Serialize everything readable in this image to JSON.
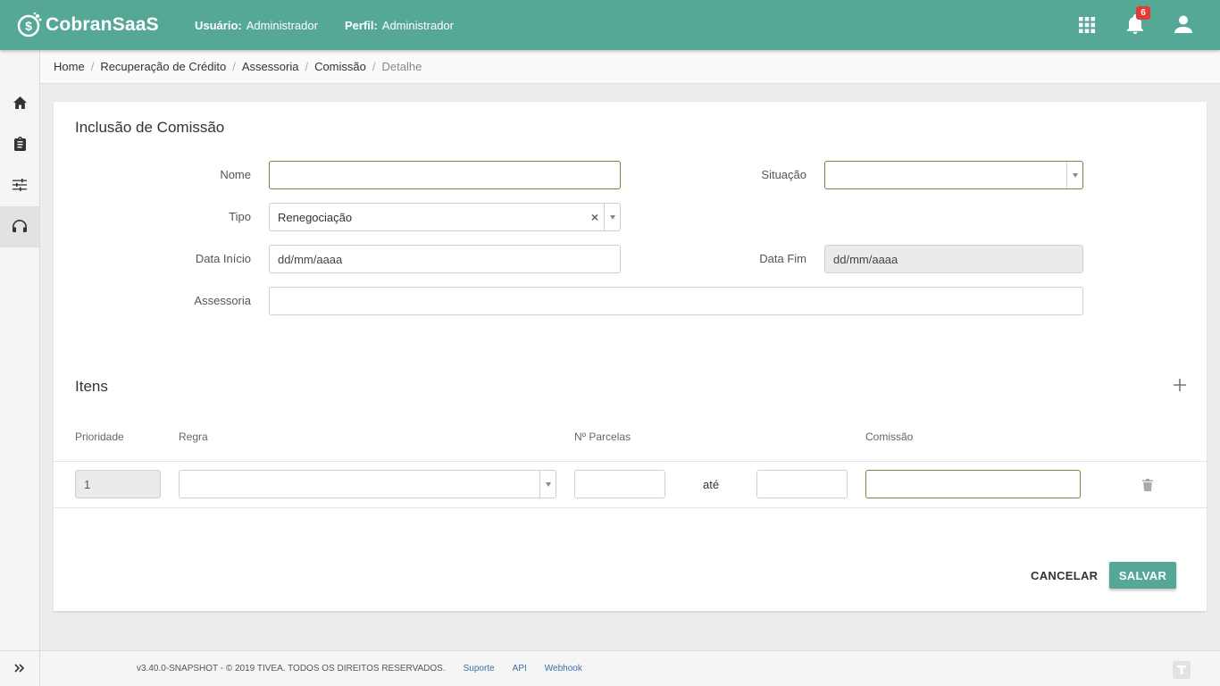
{
  "app": {
    "brand": "CobranSaaS"
  },
  "header": {
    "user_label": "Usuário:",
    "user_value": "Administrador",
    "profile_label": "Perfil:",
    "profile_value": "Administrador",
    "notifications_count": "6",
    "icons": [
      "apps-grid-icon",
      "bell-icon",
      "user-icon"
    ]
  },
  "sidebar": {
    "items": [
      {
        "icon": "home-icon"
      },
      {
        "icon": "clipboard-icon"
      },
      {
        "icon": "sliders-icon"
      },
      {
        "icon": "headset-icon"
      }
    ],
    "expand_icon": "double-chevron-right-icon"
  },
  "breadcrumb": [
    "Home",
    "Recuperação de Crédito",
    "Assessoria",
    "Comissão",
    "Detalhe"
  ],
  "form": {
    "title": "Inclusão de Comissão",
    "nome_label": "Nome",
    "nome_value": "",
    "situacao_label": "Situação",
    "situacao_value": "",
    "tipo_label": "Tipo",
    "tipo_value": "Renegociação",
    "data_inicio_label": "Data Início",
    "data_inicio_placeholder": "dd/mm/aaaa",
    "data_fim_label": "Data Fim",
    "data_fim_placeholder": "dd/mm/aaaa",
    "assessoria_label": "Assessoria",
    "assessoria_value": ""
  },
  "items": {
    "title": "Itens",
    "columns": [
      "Prioridade",
      "Regra",
      "Nº Parcelas",
      "Comissão"
    ],
    "rows": [
      {
        "prioridade": "1",
        "regra": "",
        "parcelas_de": "",
        "ate_label": "até",
        "parcelas_ate": "",
        "comissao": ""
      }
    ]
  },
  "actions": {
    "cancel": "CANCELAR",
    "save": "SALVAR"
  },
  "footer": {
    "copyright": "v3.40.0-SNAPSHOT - © 2019 TIVEA. TODOS OS DIREITOS RESERVADOS.",
    "links": [
      "Suporte",
      "API",
      "Webhook"
    ]
  },
  "colors": {
    "primary": "#55a896",
    "focus_border": "#8a7a3a",
    "badge": "#e53935"
  }
}
